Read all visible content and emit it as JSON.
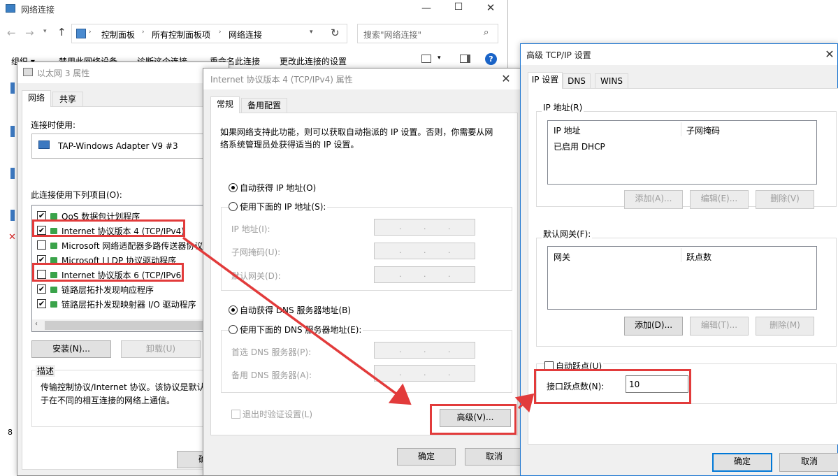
{
  "explorer": {
    "title": "网络连接",
    "breadcrumb": [
      "控制面板",
      "所有控制面板项",
      "网络连接"
    ],
    "search_placeholder": "搜索\"网络连接\"",
    "toolbar": [
      "组织 ▾",
      "禁用此网络设备",
      "诊断这个连接",
      "重命名此连接",
      "更改此连接的设置"
    ],
    "status_left": "8"
  },
  "props": {
    "title": "以太网 3 属性",
    "tabs": [
      "网络",
      "共享"
    ],
    "connect_using_label": "连接时使用:",
    "adapter": "TAP-Windows Adapter V9 #3",
    "items_label": "此连接使用下列项目(O):",
    "items": [
      {
        "label": "QoS 数据包计划程序",
        "checked": true
      },
      {
        "label": "Internet 协议版本 4 (TCP/IPv4)",
        "checked": true
      },
      {
        "label": "Microsoft 网络适配器多路传送器协议",
        "checked": false
      },
      {
        "label": "Microsoft LLDP 协议驱动程序",
        "checked": true
      },
      {
        "label": "Internet 协议版本 6 (TCP/IPv6)",
        "checked": false
      },
      {
        "label": "链路层拓扑发现响应程序",
        "checked": true
      },
      {
        "label": "链路层拓扑发现映射器 I/O 驱动程序",
        "checked": true
      }
    ],
    "install_btn": "安装(N)...",
    "uninstall_btn": "卸载(U)",
    "desc_label": "描述",
    "desc_line1": "传输控制协议/Internet 协议。该协议是默认",
    "desc_line2": "于在不同的相互连接的网络上通信。",
    "ok_btn_partial": "确"
  },
  "ipv4": {
    "title": "Internet 协议版本 4 (TCP/IPv4) 属性",
    "tabs": [
      "常规",
      "备用配置"
    ],
    "intro_line1": "如果网络支持此功能，则可以获取自动指派的 IP 设置。否则，你需要从网",
    "intro_line2": "络系统管理员处获得适当的 IP 设置。",
    "auto_ip": "自动获得 IP 地址(O)",
    "manual_ip": "使用下面的 IP 地址(S):",
    "ip_addr_label": "IP 地址(I):",
    "subnet_label": "子网掩码(U):",
    "gateway_label": "默认网关(D):",
    "auto_dns": "自动获得 DNS 服务器地址(B)",
    "manual_dns": "使用下面的 DNS 服务器地址(E):",
    "pref_dns_label": "首选 DNS 服务器(P):",
    "alt_dns_label": "备用 DNS 服务器(A):",
    "validate_label": "退出时验证设置(L)",
    "advanced_btn": "高级(V)...",
    "ok_btn": "确定",
    "cancel_btn": "取消",
    "ip_placeholder": ".       .       ."
  },
  "advanced": {
    "title": "高级 TCP/IP 设置",
    "tabs": [
      "IP 设置",
      "DNS",
      "WINS"
    ],
    "ip_group": "IP 地址(R)",
    "ip_col1": "IP 地址",
    "ip_col2": "子网掩码",
    "ip_row": "已启用 DHCP",
    "add_a": "添加(A)...",
    "edit_e": "编辑(E)...",
    "del_v": "删除(V)",
    "gw_group": "默认网关(F):",
    "gw_col1": "网关",
    "gw_col2": "跃点数",
    "add_d": "添加(D)...",
    "edit_t": "编辑(T)...",
    "del_m": "删除(M)",
    "auto_metric": "自动跃点(U)",
    "iface_metric_label": "接口跃点数(N):",
    "iface_metric_value": "10",
    "ok_btn": "确定",
    "cancel_btn": "取消"
  },
  "colors": {
    "highlight": "#e23b3b",
    "accent": "#0078d7"
  }
}
